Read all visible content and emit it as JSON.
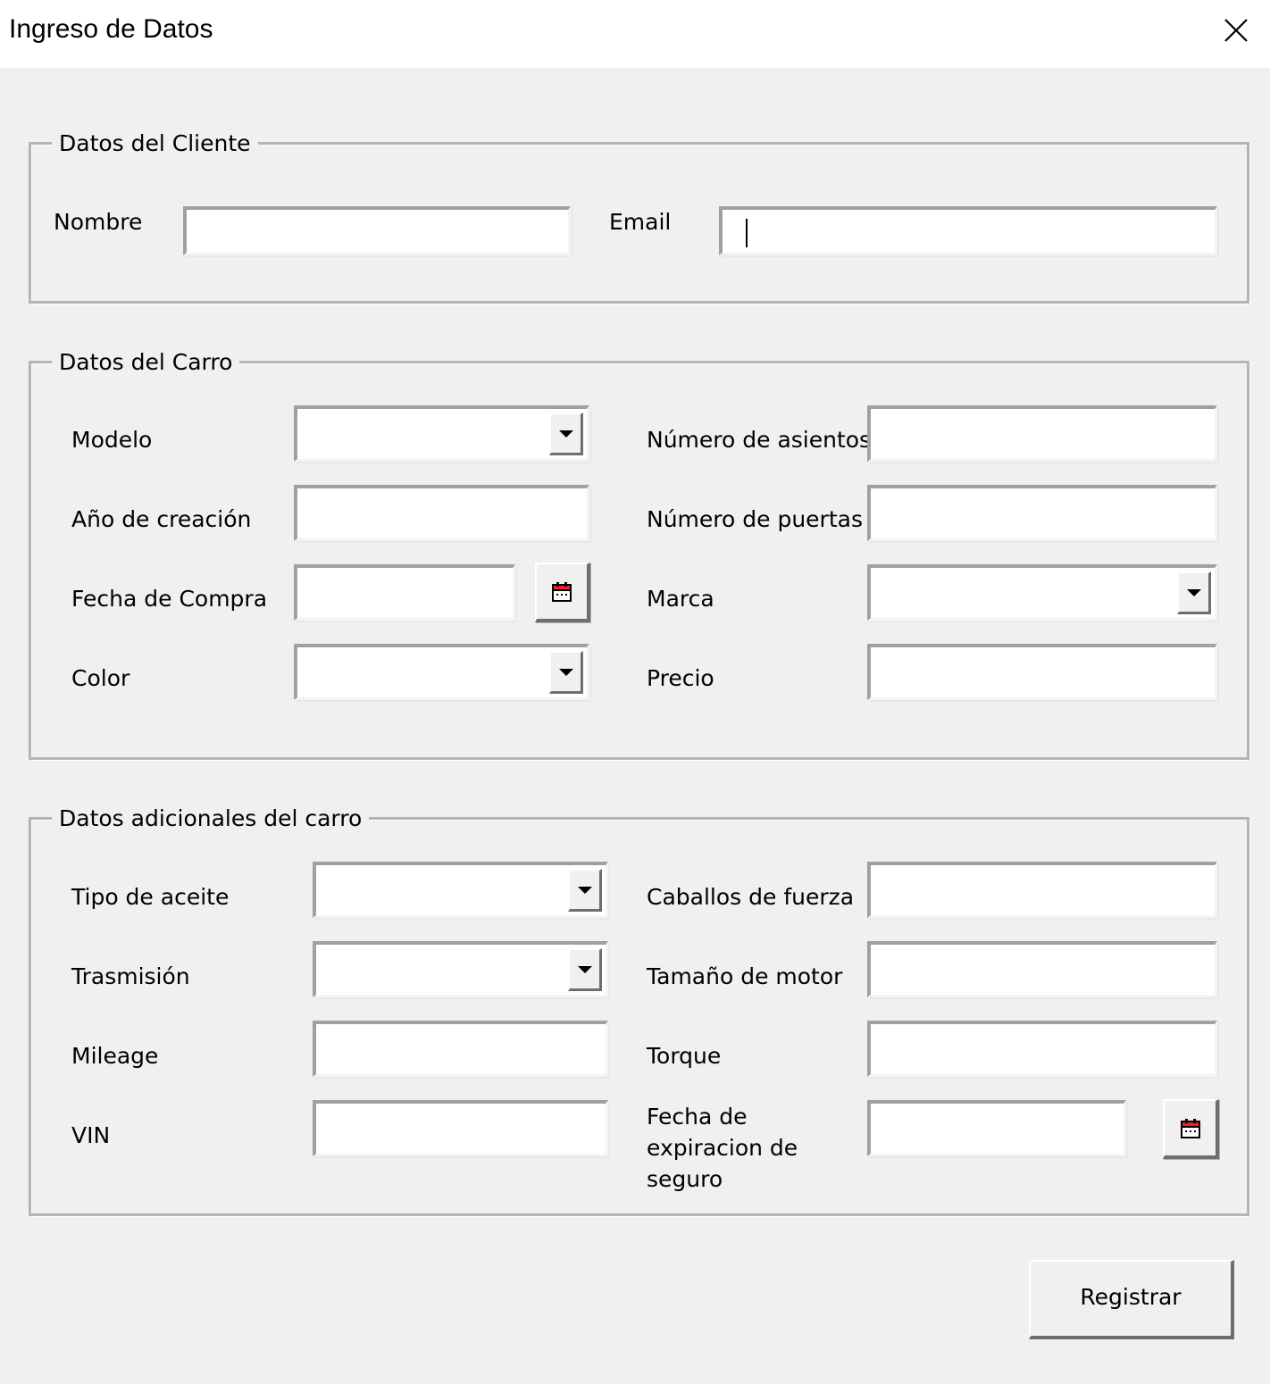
{
  "window": {
    "title": "Ingreso de Datos",
    "close_icon": "close-icon"
  },
  "cliente": {
    "legend": "Datos del Cliente",
    "nombre_label": "Nombre",
    "nombre_value": "",
    "email_label": "Email",
    "email_value": ""
  },
  "carro": {
    "legend": "Datos del Carro",
    "modelo_label": "Modelo",
    "modelo_value": "",
    "anio_label": "Año de creación",
    "anio_value": "",
    "fecha_compra_label": "Fecha de Compra",
    "fecha_compra_value": "",
    "color_label": "Color",
    "color_value": "",
    "asientos_label": "Número de asientos",
    "asientos_value": "",
    "puertas_label": "Número de puertas",
    "puertas_value": "",
    "marca_label": "Marca",
    "marca_value": "",
    "precio_label": "Precio",
    "precio_value": ""
  },
  "adicionales": {
    "legend": "Datos adicionales del carro",
    "aceite_label": "Tipo de aceite",
    "aceite_value": "",
    "trasmision_label": "Trasmisión",
    "trasmision_value": "",
    "mileage_label": "Mileage",
    "mileage_value": "",
    "vin_label": "VIN",
    "vin_value": "",
    "caballos_label": "Caballos de fuerza",
    "caballos_value": "",
    "motor_label": "Tamaño de motor",
    "motor_value": "",
    "torque_label": "Torque",
    "torque_value": "",
    "seguro_label": "Fecha de expiracion de seguro",
    "seguro_value": ""
  },
  "actions": {
    "registrar_label": "Registrar"
  },
  "colors": {
    "window_bg": "#f0f0f0",
    "titlebar_bg": "#ffffff",
    "calendar_accent": "#e8202a"
  }
}
